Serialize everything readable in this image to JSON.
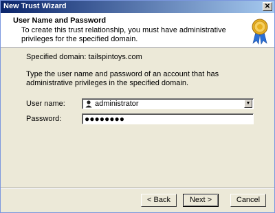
{
  "window": {
    "title": "New Trust Wizard",
    "close_glyph": "✕"
  },
  "header": {
    "title": "User Name and Password",
    "subtitle": "To create this trust relationship, you must have administrative privileges for the specified domain."
  },
  "body": {
    "specified_domain": "Specified domain: tailspintoys.com",
    "instructions": "Type the user name and password of an account that has administrative privileges in the specified domain.",
    "username_label": "User name:",
    "username_value": "administrator",
    "password_label": "Password:",
    "password_value": "●●●●●●●●"
  },
  "buttons": {
    "back": "< Back",
    "next": "Next >",
    "cancel": "Cancel"
  },
  "icons": {
    "user": "user-icon",
    "dropdown": "dropdown-arrow-icon",
    "medal": "certificate-medal-icon"
  },
  "colors": {
    "titlebar_start": "#0a246a",
    "titlebar_end": "#a6caf0",
    "medal_ribbon": "#2a6fd6",
    "medal_gold": "#e8b020"
  }
}
